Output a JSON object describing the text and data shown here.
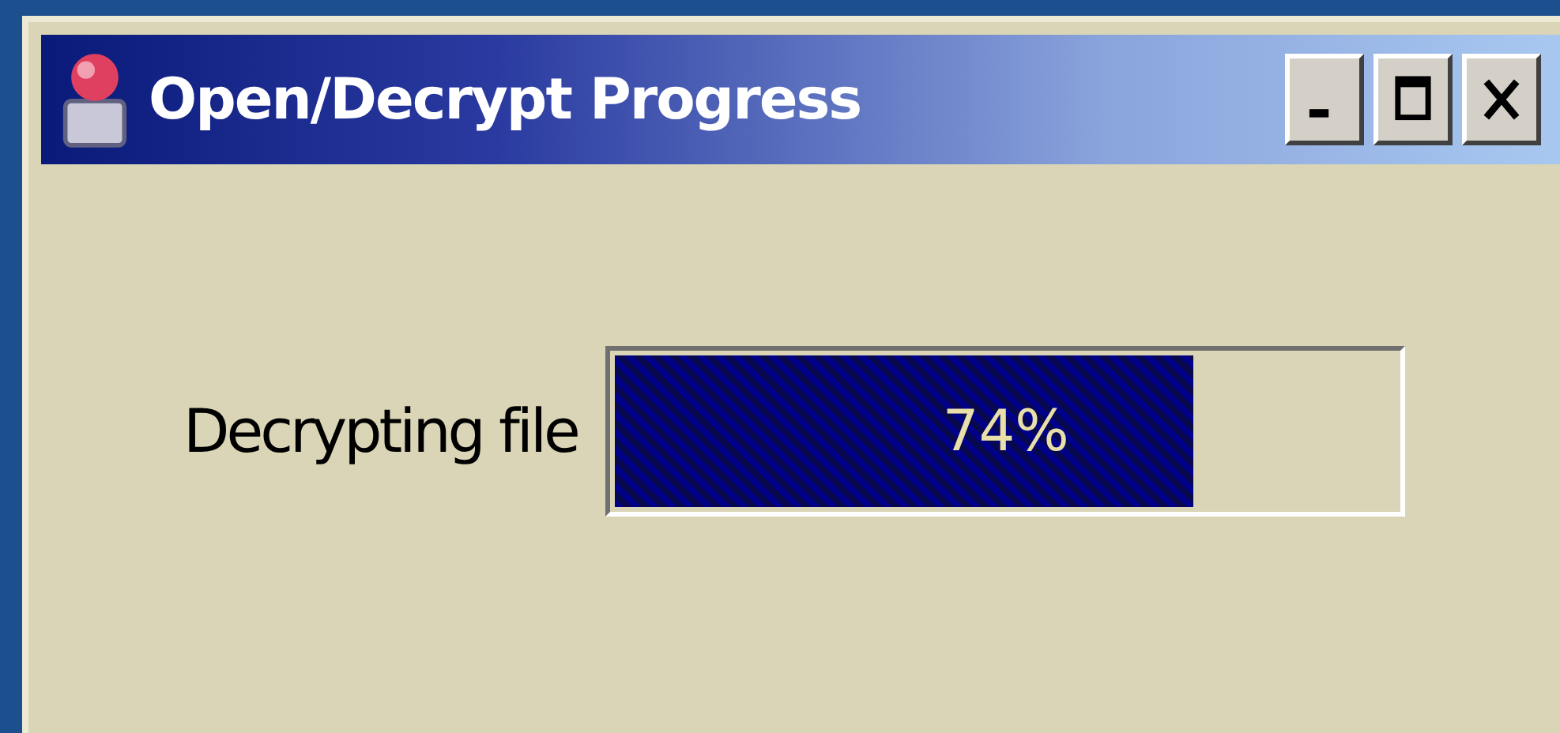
{
  "window": {
    "title": "Open/Decrypt Progress"
  },
  "title_buttons": [
    {
      "kind": "minimize"
    },
    {
      "kind": "maximize"
    },
    {
      "kind": "close"
    }
  ],
  "progress": {
    "label": "Decrypting file",
    "level": 0.74,
    "reading": "74%"
  }
}
